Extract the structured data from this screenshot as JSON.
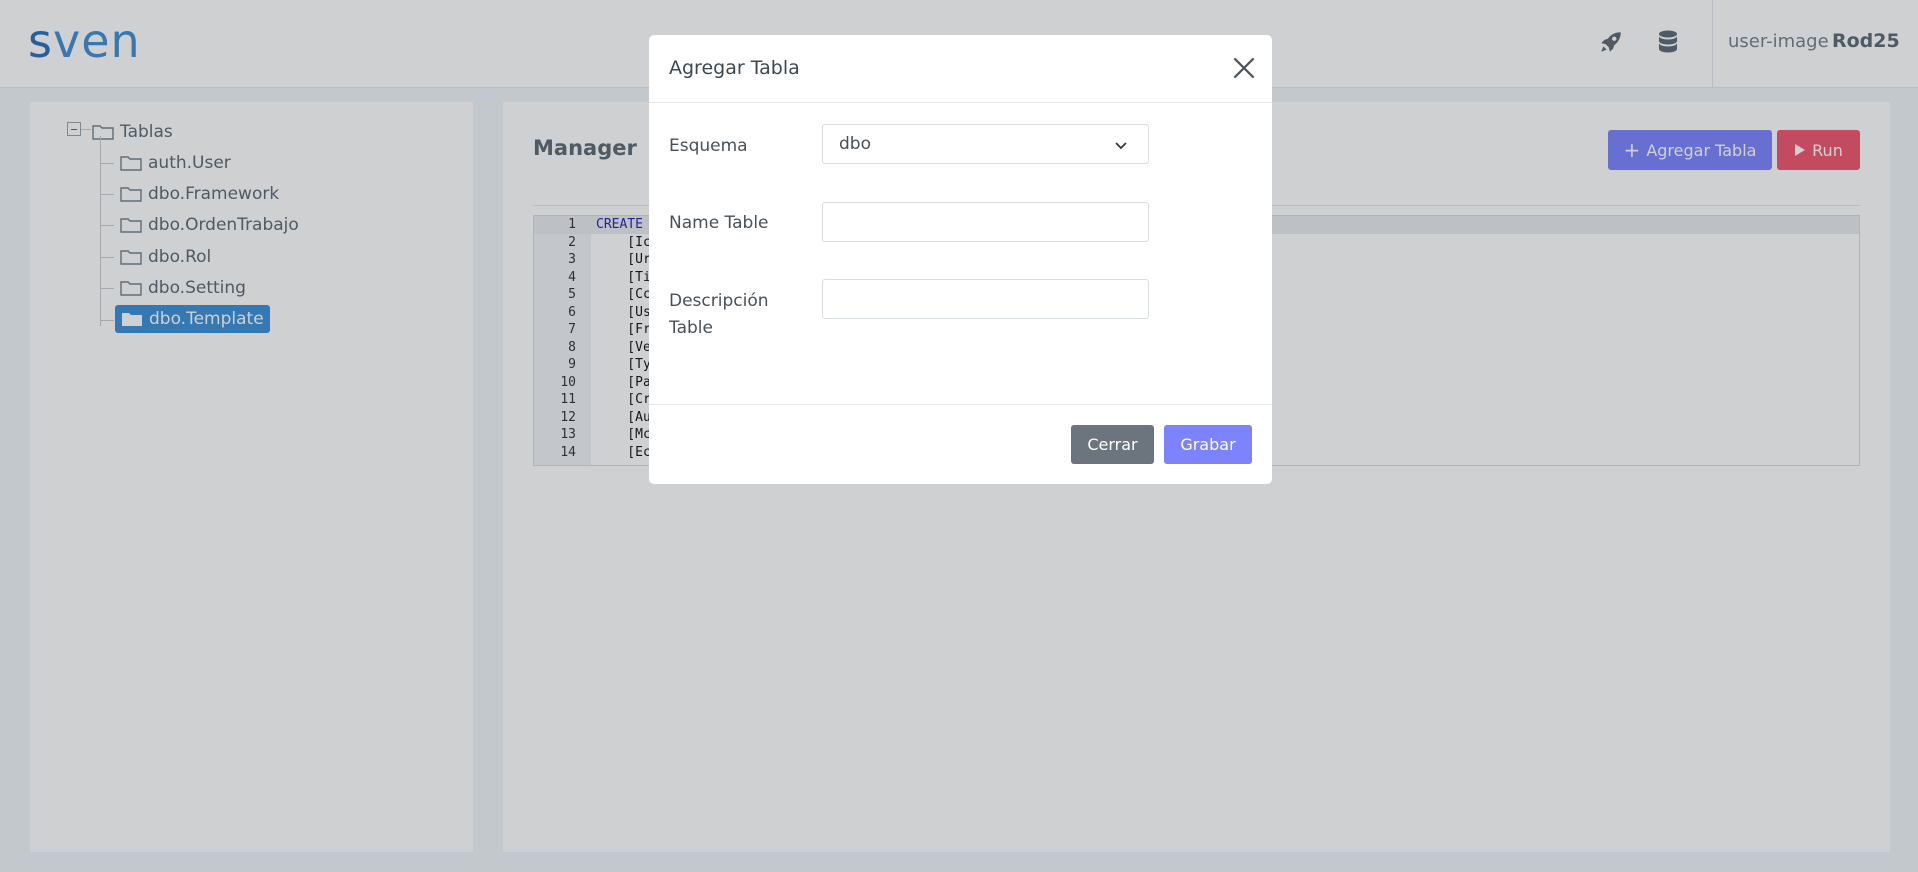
{
  "header": {
    "brand_first": "s",
    "brand_rest": "ven",
    "icons": [
      "rocket-icon",
      "database-icon"
    ],
    "user_image_alt": "user-image",
    "username": "Rod25"
  },
  "sidebar": {
    "root": "Tablas",
    "items": [
      {
        "label": "auth.User"
      },
      {
        "label": "dbo.Framework"
      },
      {
        "label": "dbo.OrdenTrabajo"
      },
      {
        "label": "dbo.Rol"
      },
      {
        "label": "dbo.Setting"
      },
      {
        "label": "dbo.Template",
        "selected": true
      }
    ]
  },
  "main": {
    "title": "Manager",
    "add_table_label": "Agregar Tabla",
    "run_label": "Run",
    "editor": {
      "lines": [
        {
          "n": "1",
          "text": "CREATE"
        },
        {
          "n": "2",
          "text": "    [Ic"
        },
        {
          "n": "3",
          "text": "    [Ur"
        },
        {
          "n": "4",
          "text": "    [Ti"
        },
        {
          "n": "5",
          "text": "    [Cc"
        },
        {
          "n": "6",
          "text": "    [Us"
        },
        {
          "n": "7",
          "text": "    [Fr"
        },
        {
          "n": "8",
          "text": "    [Ve"
        },
        {
          "n": "9",
          "text": "    [Ty"
        },
        {
          "n": "10",
          "text": "    [Pa"
        },
        {
          "n": "11",
          "text": "    [Cr"
        },
        {
          "n": "12",
          "text": "    [Au"
        },
        {
          "n": "13",
          "text": "    [Mc"
        },
        {
          "n": "14",
          "text": "    [Ec"
        }
      ]
    }
  },
  "modal": {
    "title": "Agregar Tabla",
    "schema_label": "Esquema",
    "schema_value": "dbo",
    "name_label": "Name Table",
    "name_value": "",
    "desc_label_line1": "Descripción",
    "desc_label_line2": "Table",
    "desc_value": "",
    "close_label": "Cerrar",
    "save_label": "Grabar"
  },
  "colors": {
    "primary": "#7c83fd",
    "danger": "#f0556d",
    "secondary": "#6c757d",
    "selected": "#3a8fd9"
  }
}
